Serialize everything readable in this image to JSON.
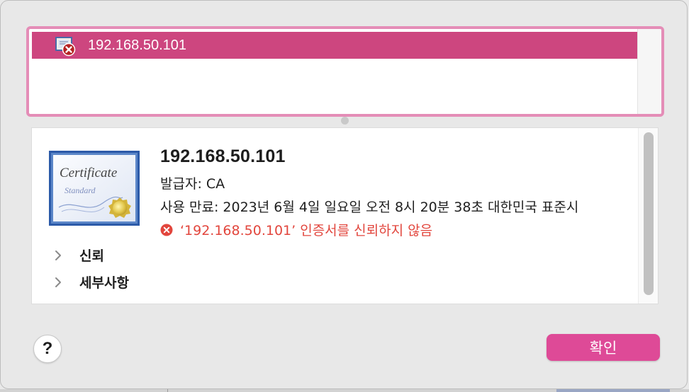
{
  "colors": {
    "accent": "#cd467f",
    "focus_ring": "#e48db7",
    "error": "#e2463d",
    "ok_button": "#de4a97"
  },
  "certificate_list": {
    "items": [
      {
        "label": "192.168.50.101",
        "icon": "certificate-error-icon",
        "selected": true
      }
    ]
  },
  "certificate_detail": {
    "image_icon": "certificate-icon",
    "image_text": {
      "title": "Certificate",
      "subtitle": "Standard"
    },
    "title": "192.168.50.101",
    "issuer": "발급자: CA",
    "expiry": "사용 만료: 2023년 6월 4일 일요일 오전 8시 20분 38초 대한민국 표준시",
    "error_message": "‘192.168.50.101’ 인증서를 신뢰하지 않음",
    "error_icon": "error-circle-icon",
    "sections": [
      {
        "label": "신뢰",
        "icon": "chevron-right-icon"
      },
      {
        "label": "세부사항",
        "icon": "chevron-right-icon"
      }
    ]
  },
  "buttons": {
    "help_label": "?",
    "ok_label": "확인"
  }
}
